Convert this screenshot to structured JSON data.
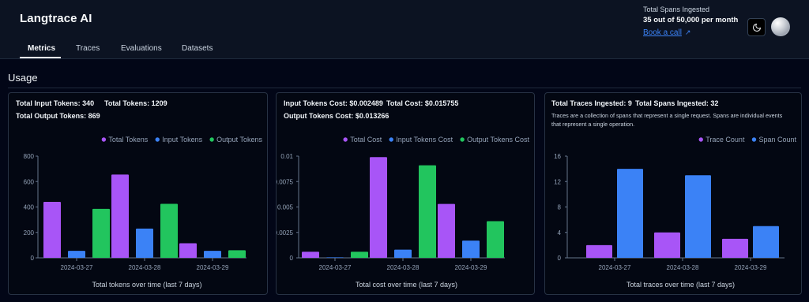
{
  "header": {
    "app_title": "Langtrace AI",
    "tabs": [
      {
        "label": "Metrics",
        "active": true
      },
      {
        "label": "Traces",
        "active": false
      },
      {
        "label": "Evaluations",
        "active": false
      },
      {
        "label": "Datasets",
        "active": false
      }
    ],
    "spans_title": "Total Spans Ingested",
    "spans_count": "35 out of 50,000 per month",
    "book_call": "Book a call",
    "book_call_icon": "arrow-up-right-icon",
    "theme_icon": "moon-icon"
  },
  "section_title": "Usage",
  "colors": {
    "purple": "#a855f7",
    "blue": "#3b82f6",
    "green": "#22c55e",
    "link": "#3b82f6"
  },
  "cards": [
    {
      "stats": [
        "Total Input Tokens: 340",
        "Total Tokens: 1209",
        "Total Output Tokens: 869"
      ],
      "description": []
    },
    {
      "stats": [
        "Input Tokens Cost: $0.002489",
        "Total Cost: $0.015755",
        "Output Tokens Cost: $0.013266"
      ],
      "description": []
    },
    {
      "stats": [
        "Total Traces Ingested: 9",
        "Total Spans Ingested: 32"
      ],
      "description": [
        "Traces are a collection of spans that represent a single request. Spans are individual events",
        "that represent a single operation."
      ]
    }
  ],
  "chart_data": [
    {
      "type": "bar",
      "categories": [
        "2024-03-27",
        "2024-03-28",
        "2024-03-29"
      ],
      "series": [
        {
          "name": "Total Tokens",
          "color": "#a855f7",
          "values": [
            440,
            655,
            115
          ]
        },
        {
          "name": "Input Tokens",
          "color": "#3b82f6",
          "values": [
            55,
            230,
            55
          ]
        },
        {
          "name": "Output Tokens",
          "color": "#22c55e",
          "values": [
            385,
            425,
            60
          ]
        }
      ],
      "yticks": [
        "800",
        "600",
        "400",
        "200",
        "0"
      ],
      "ylim": [
        0,
        800
      ],
      "xlabel": "Total tokens over time (last 7 days)",
      "grid": false,
      "legend_position": "top-right"
    },
    {
      "type": "bar",
      "categories": [
        "2024-03-27",
        "2024-03-28",
        "2024-03-29"
      ],
      "series": [
        {
          "name": "Total Cost",
          "color": "#a855f7",
          "values": [
            0.0006,
            0.0099,
            0.0053
          ]
        },
        {
          "name": "Input Tokens Cost",
          "color": "#3b82f6",
          "values": [
            5e-05,
            0.0008,
            0.0017
          ]
        },
        {
          "name": "Output Tokens Cost",
          "color": "#22c55e",
          "values": [
            0.0006,
            0.0091,
            0.0036
          ]
        }
      ],
      "yticks": [
        "0.01",
        "0.0075",
        "0.005",
        "0.0025",
        "0"
      ],
      "ylim": [
        0,
        0.01
      ],
      "xlabel": "Total cost over time (last 7 days)",
      "grid": false,
      "legend_position": "top-right"
    },
    {
      "type": "bar",
      "categories": [
        "2024-03-27",
        "2024-03-28",
        "2024-03-29"
      ],
      "series": [
        {
          "name": "Trace Count",
          "color": "#a855f7",
          "values": [
            2,
            4,
            3
          ]
        },
        {
          "name": "Span Count",
          "color": "#3b82f6",
          "values": [
            14,
            13,
            5
          ]
        }
      ],
      "yticks": [
        "16",
        "12",
        "8",
        "4",
        "0"
      ],
      "ylim": [
        0,
        16
      ],
      "xlabel": "Total traces over time (last 7 days)",
      "grid": false,
      "legend_position": "top-right"
    }
  ]
}
